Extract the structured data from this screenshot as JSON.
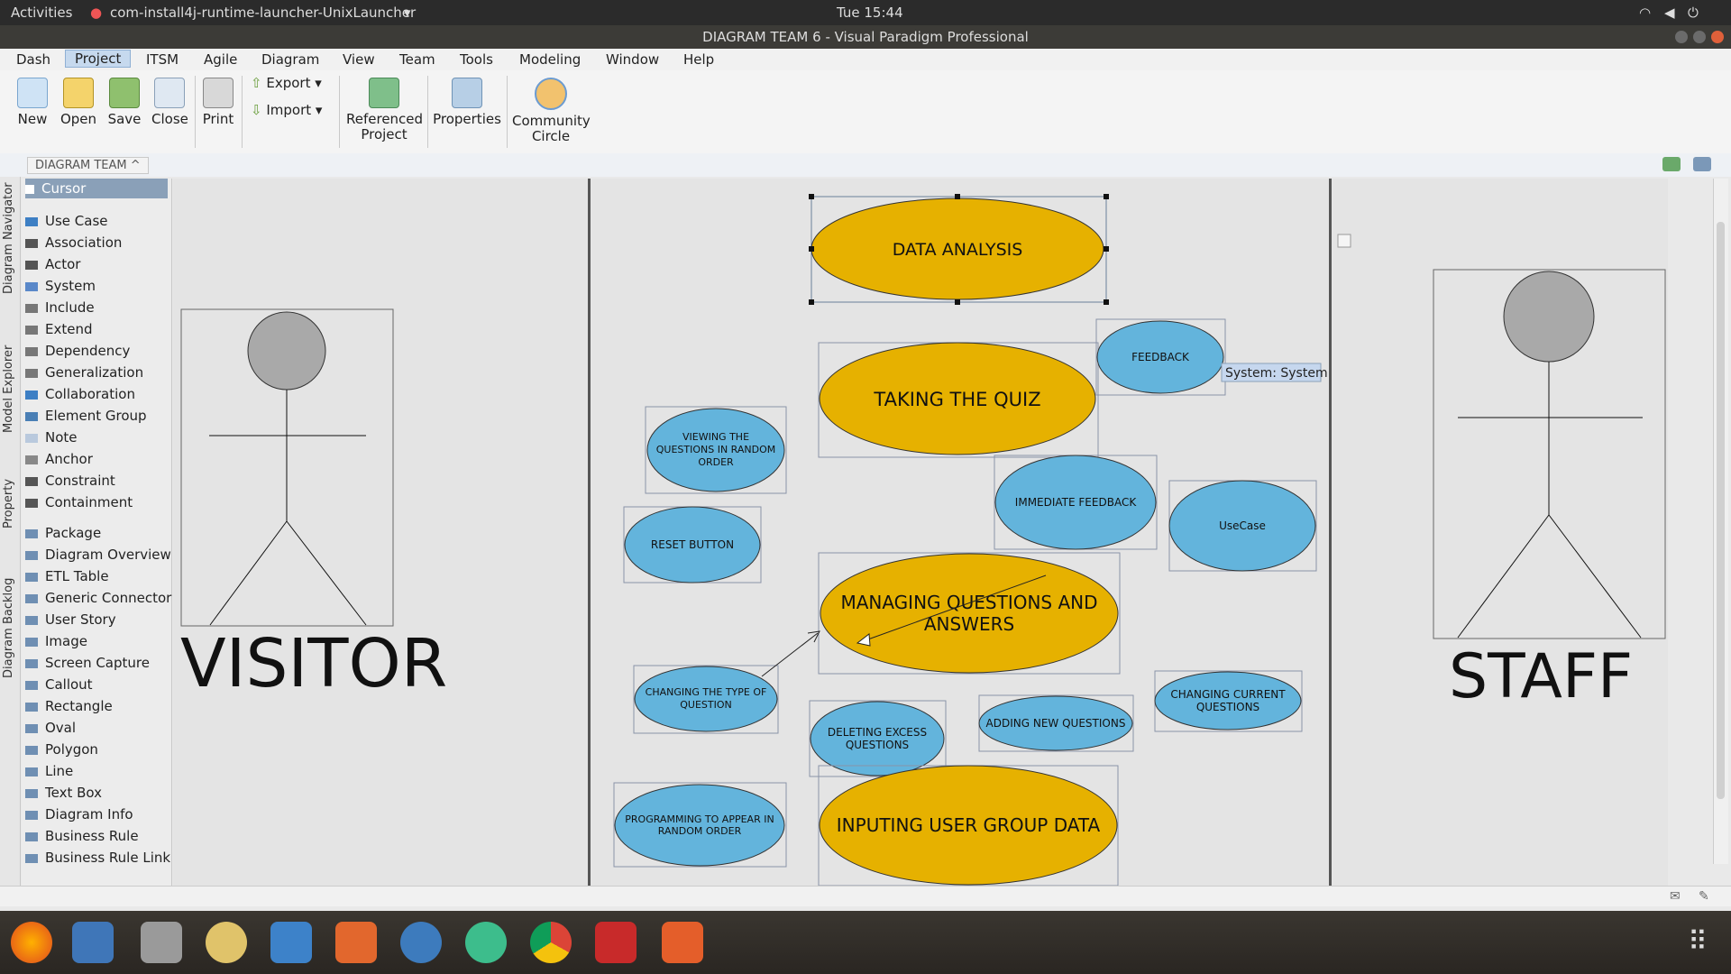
{
  "topbar": {
    "activities": "Activities",
    "app_name": "com-install4j-runtime-launcher-UnixLauncher",
    "clock": "Tue 15:44"
  },
  "window": {
    "title": "DIAGRAM TEAM 6 - Visual Paradigm Professional"
  },
  "menu": [
    "Dash",
    "Project",
    "ITSM",
    "Agile",
    "Diagram",
    "View",
    "Team",
    "Tools",
    "Modeling",
    "Window",
    "Help"
  ],
  "ribbon": {
    "new": "New",
    "open": "Open",
    "save": "Save",
    "close": "Close",
    "print": "Print",
    "export": "Export",
    "import": "Import",
    "referenced_1": "Referenced",
    "referenced_2": "Project",
    "properties": "Properties",
    "community_1": "Community",
    "community_2": "Circle"
  },
  "breadcrumb": "DIAGRAM TEAM ^",
  "side_tabs": [
    "Diagram Navigator",
    "Model Explorer",
    "Property",
    "Diagram Backlog"
  ],
  "palette": {
    "cursor": "Cursor",
    "items": [
      "Use Case",
      "Association",
      "Actor",
      "System",
      "Include",
      "Extend",
      "Dependency",
      "Generalization",
      "Collaboration",
      "Element Group",
      "Note",
      "Anchor",
      "Constraint",
      "Containment"
    ],
    "items2": [
      "Package",
      "Diagram Overview",
      "ETL Table",
      "Generic Connector",
      "User Story",
      "Image",
      "Screen Capture",
      "Callout",
      "Rectangle",
      "Oval",
      "Polygon",
      "Line",
      "Text Box",
      "Diagram Info",
      "Business Rule",
      "Business Rule Link"
    ]
  },
  "diagram": {
    "visitor": "VISITOR",
    "staff": "STAFF",
    "tooltip": "System: System",
    "usecases": {
      "data_analysis": "DATA ANALYSIS",
      "taking_quiz": "TAKING THE QUIZ",
      "feedback": "FEEDBACK",
      "viewing_1": "VIEWING THE",
      "viewing_2": "QUESTIONS IN RANDOM",
      "viewing_3": "ORDER",
      "immediate_feedback": "IMMEDIATE FEEDBACK",
      "usecase": "UseCase",
      "reset": "RESET BUTTON",
      "managing_1": "MANAGING QUESTIONS AND",
      "managing_2": "ANSWERS",
      "changing_type_1": "CHANGING THE TYPE OF",
      "changing_type_2": "QUESTION",
      "deleting_1": "DELETING EXCESS",
      "deleting_2": "QUESTIONS",
      "adding": "ADDING NEW QUESTIONS",
      "changing_current_1": "CHANGING CURRENT",
      "changing_current_2": "QUESTIONS",
      "programming_1": "PROGRAMMING TO APPEAR IN",
      "programming_2": "RANDOM ORDER",
      "inputing": "INPUTING USER GROUP DATA"
    }
  },
  "colors": {
    "gold": "#e6b100",
    "blue": "#63b4dc",
    "actor_head": "#a9a9a9"
  }
}
